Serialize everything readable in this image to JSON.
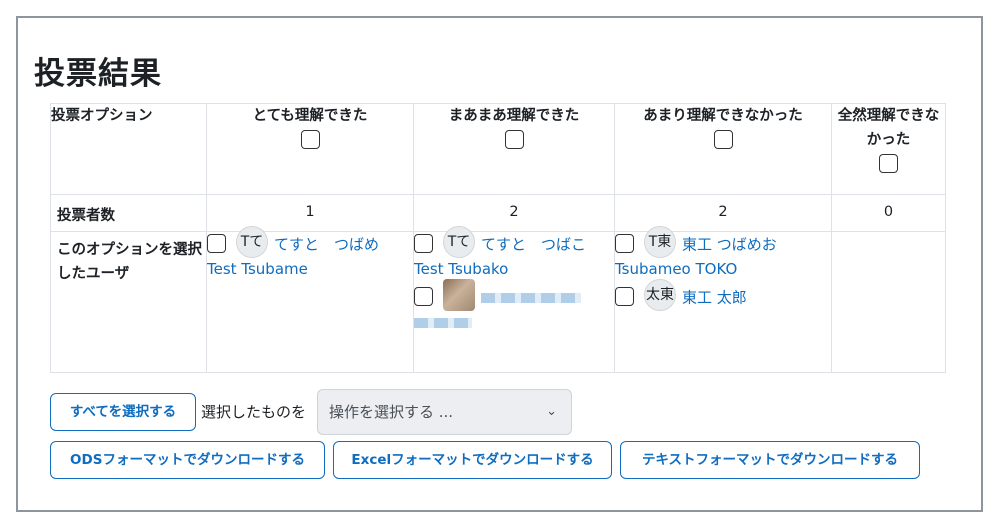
{
  "page": {
    "title": "投票結果"
  },
  "table": {
    "option_header": "投票オプション",
    "options": [
      {
        "label": "とても理解できた"
      },
      {
        "label": "まあまあ理解できた"
      },
      {
        "label": "あまり理解できなかった"
      },
      {
        "label": "全然理解できなかった"
      }
    ],
    "count_label": "投票者数",
    "counts": [
      "1",
      "2",
      "2",
      "0"
    ],
    "users_label": "このオプションを選択したユーザ",
    "users": {
      "col1": [
        {
          "initials": "Tて",
          "name": "てすと　つばめ Test Tsubame"
        }
      ],
      "col2": [
        {
          "initials": "Tて",
          "name": "てすと　つばこ Test Tsubako"
        }
      ],
      "col3": [
        {
          "initials": "T東",
          "name": "東工 つばめお Tsubameo TOKO"
        },
        {
          "initials": "太東",
          "name": "東工 太郎"
        }
      ]
    }
  },
  "actions": {
    "select_all": "すべてを選択する",
    "with_selected": "選択したものを",
    "action_select": {
      "value": "操作を選択する ...",
      "icon": "chevron-down-icon"
    },
    "download_ods": "ODSフォーマットでダウンロードする",
    "download_excel": "Excelフォーマットでダウンロードする",
    "download_text": "テキストフォーマットでダウンロードする"
  },
  "colors": {
    "link": "#0f6cbf",
    "border": "#dee2e6",
    "select_bg": "#eceef1"
  }
}
